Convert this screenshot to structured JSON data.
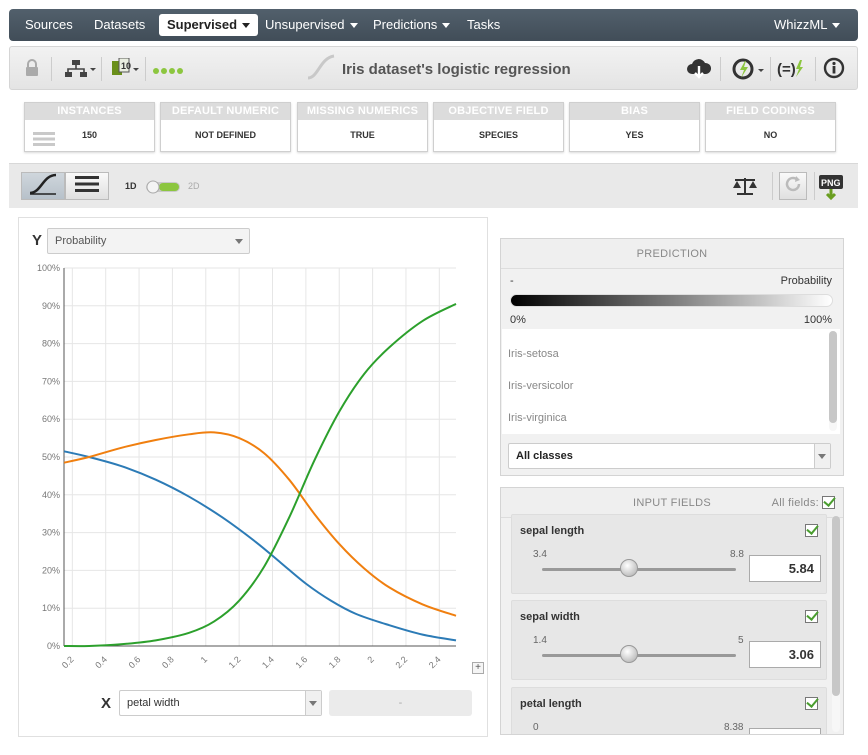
{
  "nav": {
    "items": [
      {
        "label": "Sources"
      },
      {
        "label": "Datasets"
      },
      {
        "label": "Supervised"
      },
      {
        "label": "Unsupervised"
      },
      {
        "label": "Predictions"
      },
      {
        "label": "Tasks"
      }
    ],
    "user_menu": "WhizzML"
  },
  "toolbar": {
    "title": "Iris dataset's logistic regression",
    "icons": [
      "lock-icon",
      "tree-icon",
      "filter-icon",
      "dots-icon",
      "cloud-download-icon",
      "actions-icon",
      "formula-icon",
      "info-icon"
    ]
  },
  "info_boxes": [
    {
      "label": "INSTANCES",
      "value": "150"
    },
    {
      "label": "DEFAULT NUMERIC",
      "value": "NOT DEFINED"
    },
    {
      "label": "MISSING NUMERICS",
      "value": "TRUE"
    },
    {
      "label": "OBJECTIVE FIELD",
      "value": "SPECIES"
    },
    {
      "label": "BIAS",
      "value": "YES"
    },
    {
      "label": "FIELD CODINGS",
      "value": "NO"
    }
  ],
  "view_controls": {
    "toggle_1d": "1D",
    "toggle_2d": "2D",
    "toggle_state": "1D"
  },
  "chart_controls": {
    "y_label": "Y",
    "y_select": "Probability",
    "x_label": "X",
    "x_select": "petal width",
    "x_secondary": "-",
    "expand_label": "+"
  },
  "chart_data": {
    "type": "line",
    "xlabel": "",
    "ylabel": "",
    "xlim": [
      0.15,
      2.5
    ],
    "ylim": [
      0,
      100
    ],
    "x_ticks": [
      "0.2",
      "0.4",
      "0.6",
      "0.8",
      "1",
      "1.2",
      "1.4",
      "1.6",
      "1.8",
      "2",
      "2.2",
      "2.4"
    ],
    "y_ticks": [
      "0%",
      "10%",
      "20%",
      "30%",
      "40%",
      "50%",
      "60%",
      "70%",
      "80%",
      "90%",
      "100%"
    ],
    "grid": true,
    "series": [
      {
        "color": "#2c7bb6",
        "x": [
          0.15,
          0.3,
          0.5,
          0.7,
          0.9,
          1.1,
          1.3,
          1.45,
          1.6,
          1.75,
          1.9,
          2.1,
          2.3,
          2.5
        ],
        "values": [
          51.5,
          50,
          47.5,
          44,
          39.5,
          34,
          27.5,
          22,
          16.5,
          12,
          8.5,
          5.5,
          3,
          1.5
        ]
      },
      {
        "color": "#f07f0f",
        "x": [
          0.15,
          0.3,
          0.5,
          0.7,
          0.9,
          1.05,
          1.2,
          1.35,
          1.5,
          1.65,
          1.8,
          1.95,
          2.1,
          2.3,
          2.5
        ],
        "values": [
          48.5,
          50,
          52.5,
          54.5,
          56,
          56.5,
          55,
          51,
          44,
          35,
          27,
          20.5,
          15.5,
          11,
          8
        ]
      },
      {
        "color": "#2ca02c",
        "x": [
          0.15,
          0.3,
          0.5,
          0.7,
          0.9,
          1.05,
          1.2,
          1.35,
          1.5,
          1.65,
          1.8,
          1.95,
          2.1,
          2.3,
          2.5
        ],
        "values": [
          0,
          0,
          0.5,
          1.5,
          3.5,
          6.5,
          12,
          21,
          34,
          49,
          62,
          72,
          79,
          86,
          90.5
        ]
      }
    ]
  },
  "prediction": {
    "header": "PREDICTION",
    "left_label": "-",
    "right_label": "Probability",
    "scale_min": "0%",
    "scale_max": "100%",
    "classes": [
      "Iris-setosa",
      "Iris-versicolor",
      "Iris-virginica"
    ],
    "class_select": "All classes"
  },
  "inputs": {
    "header": "INPUT FIELDS",
    "all_fields_label": "All fields:",
    "fields": [
      {
        "name": "sepal length",
        "min": "3.4",
        "max": "8.8",
        "value": "5.84",
        "fraction": 0.45
      },
      {
        "name": "sepal width",
        "min": "1.4",
        "max": "5",
        "value": "3.06",
        "fraction": 0.45
      },
      {
        "name": "petal length",
        "min": "0",
        "max": "8.38",
        "value": ""
      }
    ]
  }
}
